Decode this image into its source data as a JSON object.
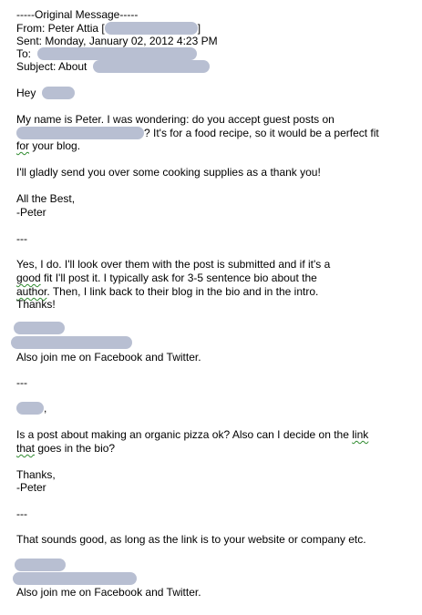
{
  "header": {
    "separator": "-----Original Message-----",
    "from_prefix": "From: Peter Attia [",
    "from_suffix": "]",
    "sent": "Sent: Monday, January 02, 2012 4:23 PM",
    "to_prefix": "To:",
    "subject_prefix": "Subject: About"
  },
  "message1": {
    "greeting": "Hey",
    "line1": "My name is Peter. I was wondering: do you accept guest posts on",
    "line2_after_redact": "? It's for a food recipe, so it would be a perfect fit",
    "line3_word_underlined": "for",
    "line3_rest": " your blog.",
    "line4": "I'll gladly send you over some cooking supplies as a thank you!",
    "closing": "All the Best,",
    "signature": "-Peter"
  },
  "sep1": "---",
  "reply1": {
    "line1": "Yes, I do.  I'll look over them with the post is submitted and if it's a",
    "line2_word_underlined": "good",
    "line2_rest": " fit I'll post it.  I typically ask for 3-5 sentence bio about the",
    "line3_word_underlined": "author",
    "line3_rest": ".  Then, I link back to their blog in the bio and in the intro.",
    "line4": "Thanks!",
    "social": "Also join me on Facebook and Twitter."
  },
  "sep2": "---",
  "message2": {
    "greeting_suffix": ",",
    "line1_before_link": "Is a post about making an organic pizza ok? Also can I decide on the ",
    "line1_link_word": "link",
    "line2_word_underlined": "that",
    "line2_rest": " goes in the bio?",
    "closing": "Thanks,",
    "signature": "-Peter"
  },
  "sep3": "---",
  "reply2": {
    "line1": "That sounds good, as long as the link is to your website or company etc.",
    "social": "Also join me on Facebook and Twitter."
  }
}
